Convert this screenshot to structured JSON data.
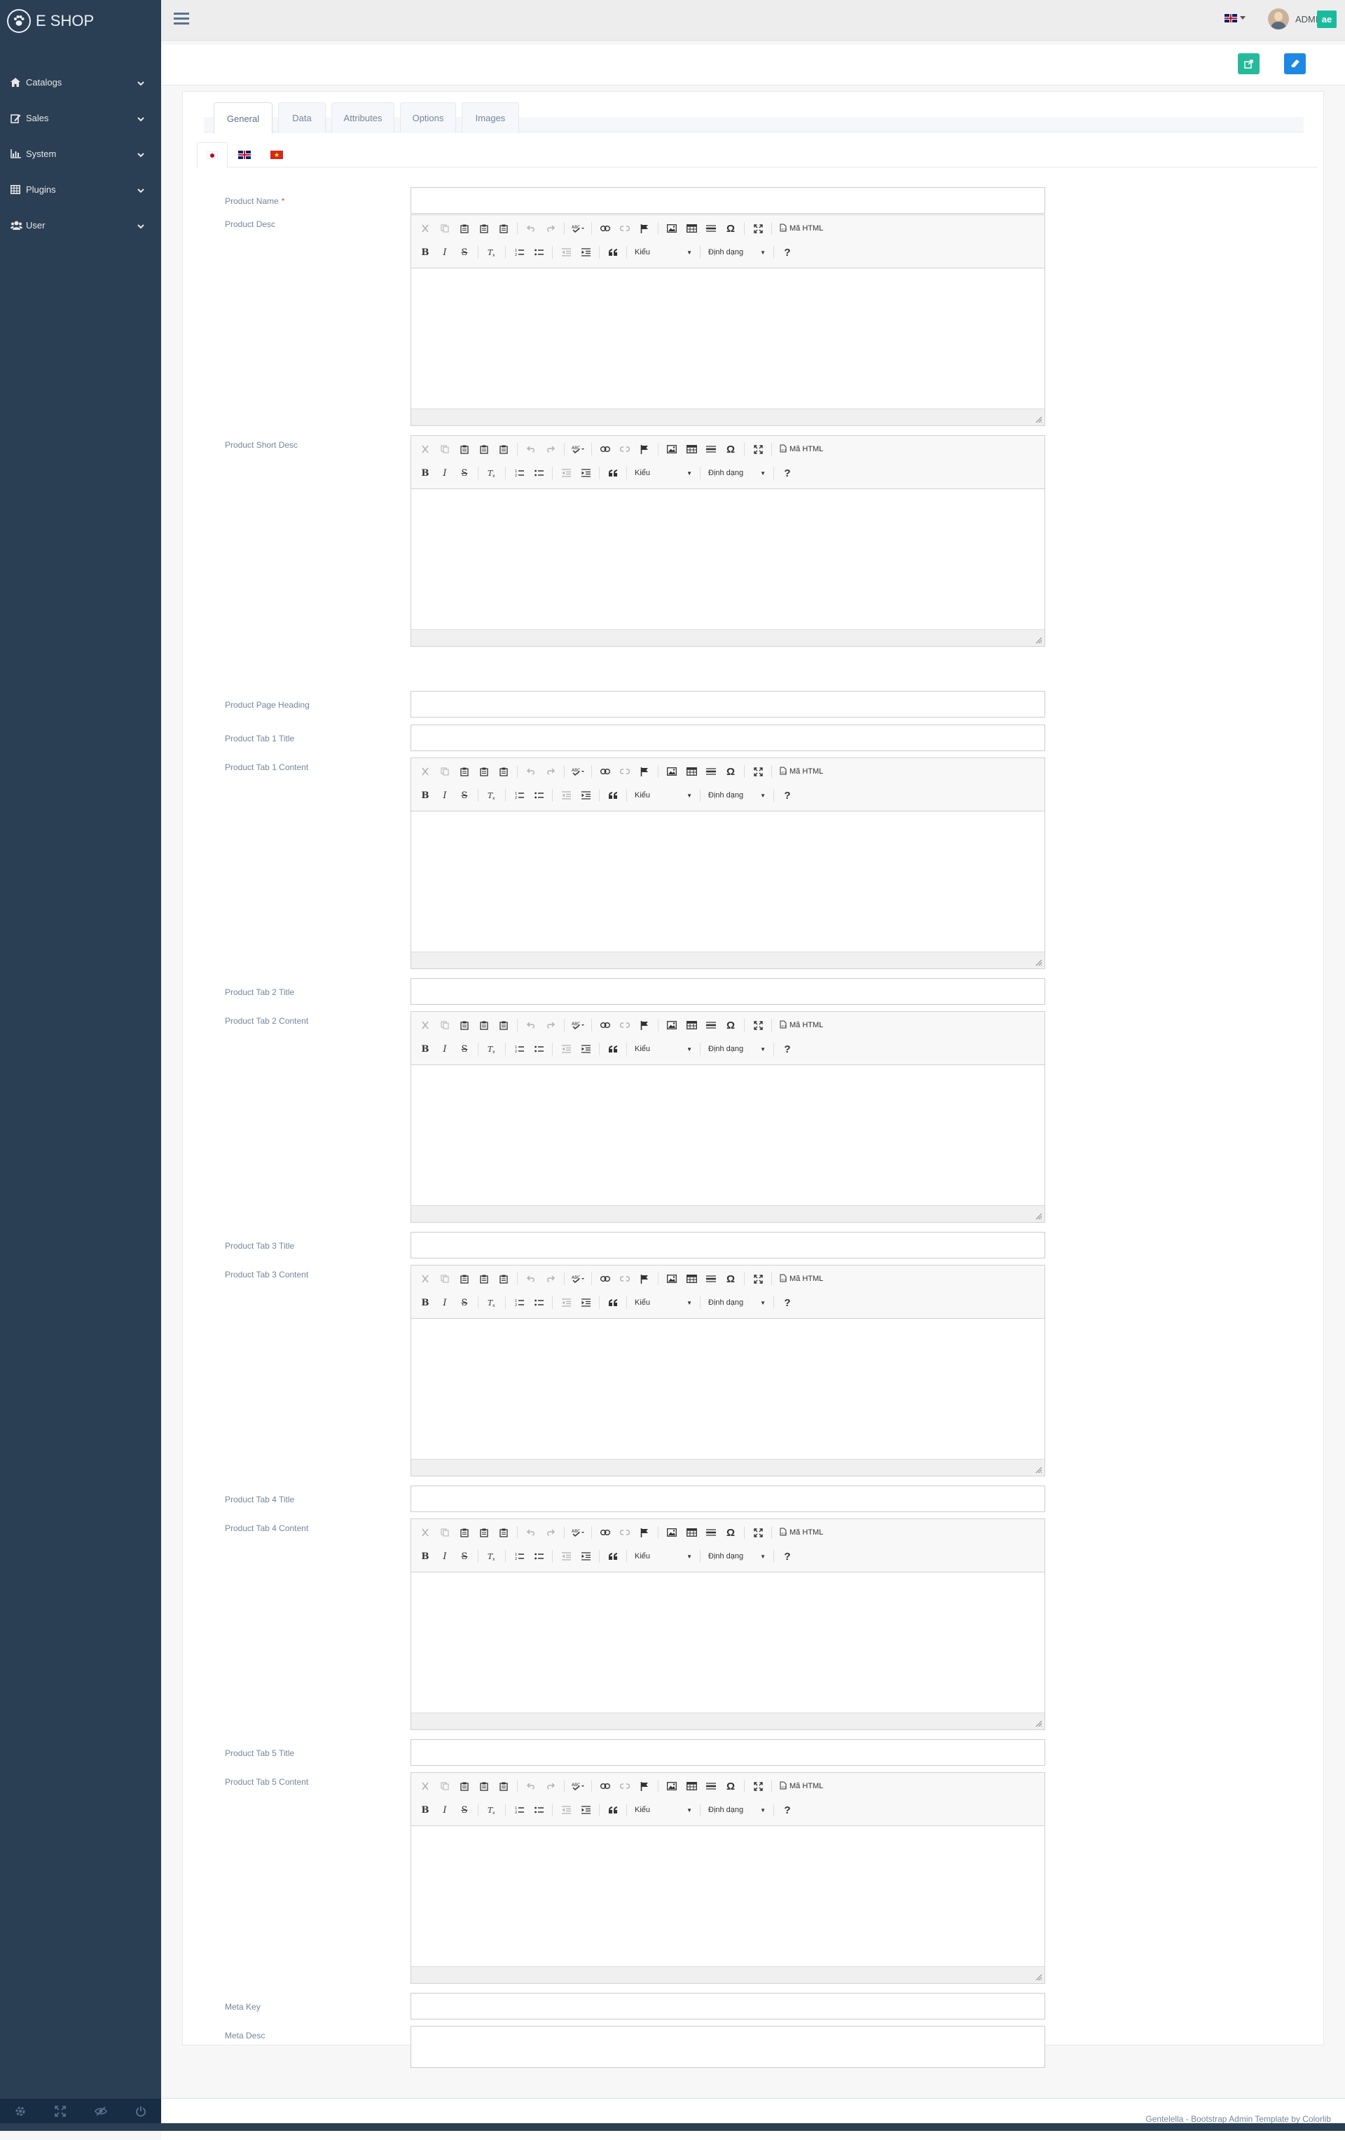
{
  "app": {
    "brand": "E SHOP",
    "admin_name": "ADMIN",
    "admin_badge": "ae"
  },
  "sidebar": {
    "items": [
      {
        "label": "Catalogs",
        "icon": "home-icon"
      },
      {
        "label": "Sales",
        "icon": "edit-icon"
      },
      {
        "label": "System",
        "icon": "bar-chart-icon"
      },
      {
        "label": "Plugins",
        "icon": "table-icon"
      },
      {
        "label": "User",
        "icon": "users-icon"
      }
    ],
    "footer_icons": [
      "settings-icon",
      "fullscreen-icon",
      "lock-icon",
      "logout-icon"
    ]
  },
  "tabs": [
    {
      "label": "General",
      "active": true
    },
    {
      "label": "Data"
    },
    {
      "label": "Attributes"
    },
    {
      "label": "Options"
    },
    {
      "label": "Images"
    }
  ],
  "lang_tabs": [
    {
      "flag": "jp",
      "active": true
    },
    {
      "flag": "gb"
    },
    {
      "flag": "vn"
    }
  ],
  "form": {
    "product_name": "Product Name",
    "product_desc": "Product Desc",
    "product_short_desc": "Product Short Desc",
    "product_page_heading": "Product Page Heading",
    "tab1_title": "Product Tab 1 Title",
    "tab1_content": "Product Tab 1 Content",
    "tab2_title": "Product Tab 2 Title",
    "tab2_content": "Product Tab 2 Content",
    "tab3_title": "Product Tab 3 Title",
    "tab3_content": "Product Tab 3 Content",
    "tab4_title": "Product Tab 4 Title",
    "tab4_content": "Product Tab 4 Content",
    "tab5_title": "Product Tab 5 Title",
    "tab5_content": "Product Tab 5 Content",
    "meta_key": "Meta Key",
    "meta_desc": "Meta Desc",
    "required_mark": "*"
  },
  "editor": {
    "source_label": "Mã HTML",
    "style_label": "Kiểu",
    "format_label": "Định dạng",
    "help_label": "?"
  },
  "footer": {
    "text": "Gentelella - Bootstrap Admin Template by Colorlib"
  },
  "colors": {
    "sidebar": "#2A3F54",
    "accent_green": "#26B99A",
    "accent_blue": "#1E88E5",
    "badge": "#1ABB9C"
  }
}
